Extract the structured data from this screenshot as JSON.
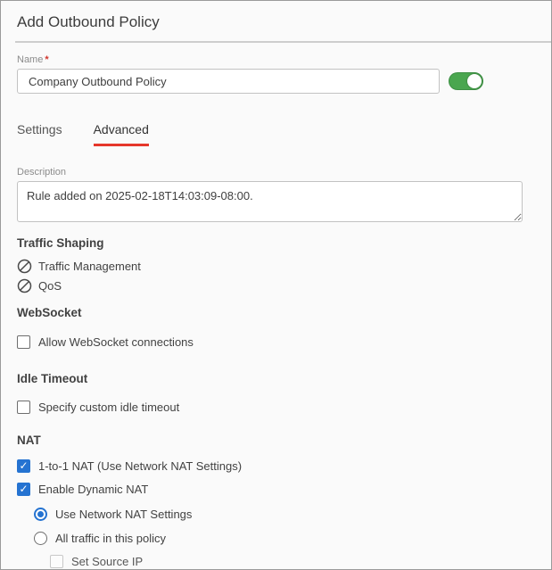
{
  "window": {
    "title": "Add Outbound Policy"
  },
  "name_field": {
    "label": "Name",
    "required_marker": "*",
    "value": "Company Outbound Policy",
    "toggle_on": true
  },
  "tabs": {
    "settings_label": "Settings",
    "advanced_label": "Advanced",
    "active_tab": "Advanced"
  },
  "description_field": {
    "label": "Description",
    "value": "Rule added on 2025-02-18T14:03:09-08:00."
  },
  "traffic_shaping": {
    "heading": "Traffic Shaping",
    "items": [
      {
        "label": "Traffic Management",
        "icon": "prohibited-icon"
      },
      {
        "label": "QoS",
        "icon": "prohibited-icon"
      }
    ]
  },
  "websocket": {
    "heading": "WebSocket",
    "allow_checkbox": {
      "label": "Allow WebSocket connections",
      "checked": false
    }
  },
  "idle_timeout": {
    "heading": "Idle Timeout",
    "custom_checkbox": {
      "label": "Specify custom idle timeout",
      "checked": false
    }
  },
  "nat": {
    "heading": "NAT",
    "one_to_one_checkbox": {
      "label": "1-to-1 NAT (Use Network NAT Settings)",
      "checked": true
    },
    "dynamic_checkbox": {
      "label": "Enable Dynamic NAT",
      "checked": true
    },
    "radio_use_network": {
      "label": "Use Network NAT Settings",
      "selected": true
    },
    "radio_all_traffic": {
      "label": "All traffic in this policy",
      "selected": false
    },
    "set_source_ip_checkbox": {
      "label": "Set Source IP",
      "checked": false,
      "disabled": true
    }
  },
  "colors": {
    "toggle_green": "#4aa64f",
    "tab_underline_red": "#e5372b",
    "selection_blue": "#2573d1",
    "required_red": "#d0342c"
  }
}
